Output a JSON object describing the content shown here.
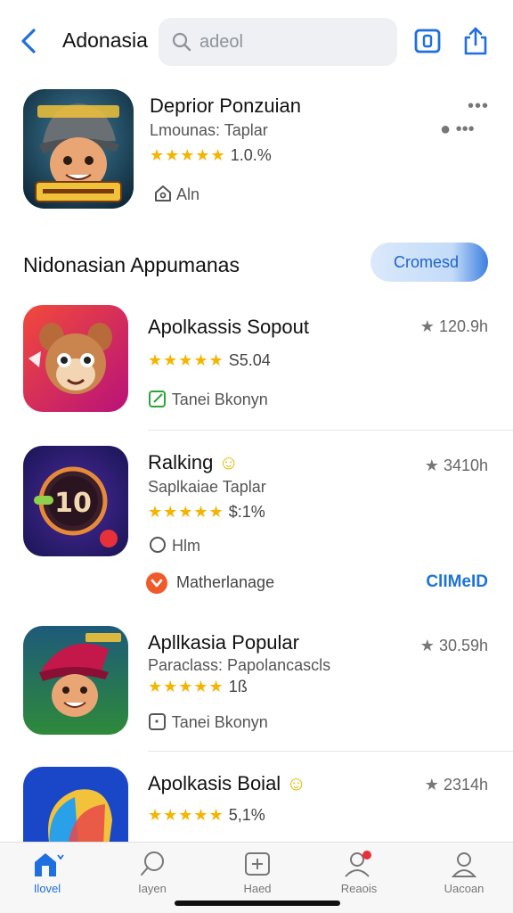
{
  "header": {
    "title": "Adonasia",
    "search_text": "adeol",
    "icons": [
      "back-icon",
      "search-icon",
      "square-icon",
      "share-icon"
    ]
  },
  "featured": {
    "title": "Deprior Ponzuian",
    "subtitle": "Lmounas: Taplar",
    "stars": "★★★★★",
    "rating": "1.0.%",
    "action": "Aln"
  },
  "section": {
    "title": "Nidonasian Appumanas",
    "button_label": "Cromesd"
  },
  "apps": [
    {
      "name": "Apolkassis Sopout",
      "stars": "★★★★★",
      "rating": "S5.04",
      "action": "Tanei  Bkonyn",
      "meta": "120.9h"
    },
    {
      "name": "Ralking",
      "subtitle": "Saplkaiae Taplar",
      "stars": "★★★★★",
      "rating": "$:1%",
      "action": "Hlm",
      "meta": "3410h"
    },
    {
      "name": "Apllkasia Popular",
      "subtitle": "Paraclass: Papolancascls",
      "stars": "★★★★★",
      "rating": "1ß",
      "action": "Tanei  Bkonyn",
      "meta": "30.59h"
    },
    {
      "name": "Apolkasis Boial",
      "stars": "★★★★★",
      "rating": "5,1%",
      "meta": "2314h"
    }
  ],
  "sponsor": {
    "label": "Matherlanage",
    "cta": "ClIMeID"
  },
  "tabs": [
    {
      "label": "Ilovel",
      "active": true
    },
    {
      "label": "Iayen",
      "active": false
    },
    {
      "label": "Haed",
      "active": false
    },
    {
      "label": "Reaois",
      "active": false
    },
    {
      "label": "Uacoan",
      "active": false
    }
  ],
  "colors": {
    "accent": "#1f6fe0",
    "star": "#f5b400",
    "sponsor_dot": "#ef5a2a"
  }
}
